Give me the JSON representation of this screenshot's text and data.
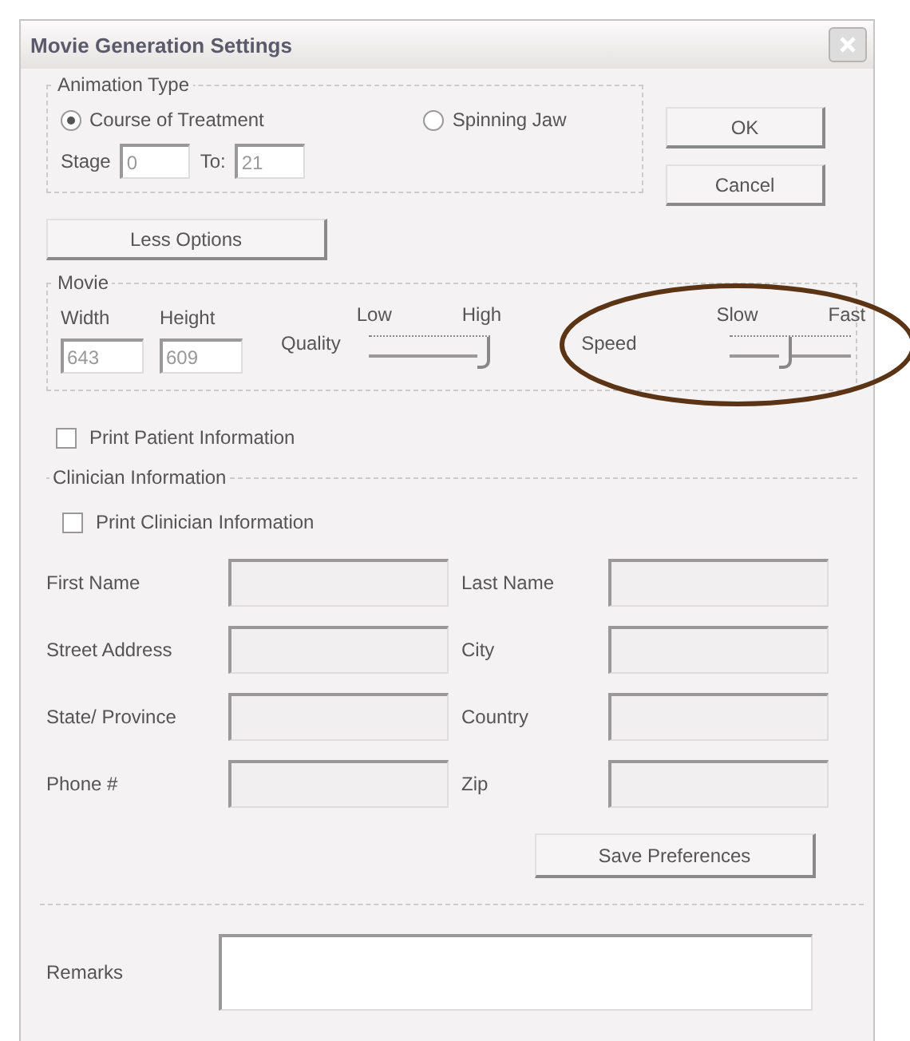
{
  "window": {
    "title": "Movie Generation Settings"
  },
  "animation_type": {
    "legend": "Animation Type",
    "options": [
      {
        "label": "Course of Treatment",
        "selected": true
      },
      {
        "label": "Spinning Jaw",
        "selected": false
      }
    ],
    "stage_label": "Stage",
    "stage_value": "0",
    "to_label": "To:",
    "to_value": "21"
  },
  "buttons": {
    "ok": "OK",
    "cancel": "Cancel",
    "less_options": "Less Options",
    "save_preferences": "Save Preferences"
  },
  "movie": {
    "legend": "Movie",
    "width_label": "Width",
    "height_label": "Height",
    "width_value": "643",
    "height_value": "609",
    "quality": {
      "label": "Quality",
      "low": "Low",
      "high": "High",
      "level": 1
    },
    "speed": {
      "label": "Speed",
      "slow": "Slow",
      "fast": "Fast",
      "level": 0.45
    }
  },
  "print_patient": {
    "label": "Print Patient Information",
    "checked": false
  },
  "clinician": {
    "legend": "Clinician Information",
    "print": {
      "label": "Print Clinician Information",
      "checked": false
    },
    "fields": [
      {
        "label": "First Name"
      },
      {
        "label": "Last Name"
      },
      {
        "label": "Street Address"
      },
      {
        "label": "City"
      },
      {
        "label": "State/ Province"
      },
      {
        "label": "Country"
      },
      {
        "label": "Phone #"
      },
      {
        "label": "Zip"
      }
    ]
  },
  "remarks": {
    "label": "Remarks"
  }
}
